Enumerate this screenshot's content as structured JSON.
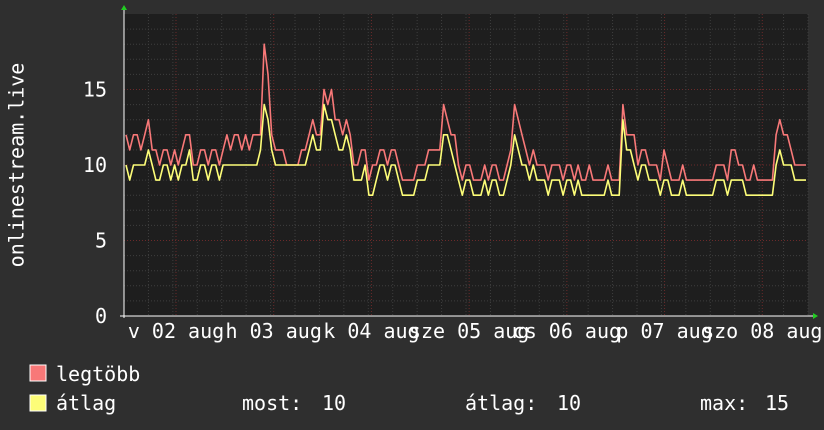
{
  "chart_data": {
    "type": "line",
    "ylabel": "onlinestream.live",
    "ylim": [
      0,
      20
    ],
    "yticks": [
      0,
      5,
      10,
      15
    ],
    "x_ticks": [
      "v 02 aug",
      "h 03 aug",
      "k 04 aug",
      "sze 05 aug",
      "cs 06 aug",
      "p 07 aug",
      "szo 08 aug"
    ],
    "grid": true,
    "colors": {
      "max": "#f87878",
      "avg": "#fdfd78",
      "background": "#1e1e1e",
      "grid_major": "#6b2a2a",
      "grid_minor": "#3e3e3e"
    },
    "series": [
      {
        "name": "legtöbb",
        "values": [
          12,
          11,
          12,
          12,
          11,
          12,
          13,
          11,
          11,
          10,
          11,
          11,
          10,
          11,
          10,
          11,
          12,
          12,
          10,
          10,
          11,
          11,
          10,
          11,
          11,
          10,
          11,
          12,
          11,
          12,
          12,
          11,
          12,
          11,
          12,
          12,
          12,
          18,
          16,
          12,
          11,
          11,
          11,
          10,
          10,
          10,
          10,
          11,
          11,
          12,
          13,
          12,
          12,
          15,
          14,
          15,
          13,
          13,
          12,
          13,
          12,
          10,
          10,
          11,
          11,
          9,
          10,
          10,
          11,
          11,
          10,
          11,
          11,
          10,
          9,
          9,
          9,
          9,
          10,
          10,
          10,
          11,
          11,
          11,
          11,
          14,
          13,
          12,
          12,
          10,
          9,
          10,
          10,
          9,
          9,
          9,
          10,
          9,
          10,
          10,
          9,
          9,
          10,
          11,
          14,
          13,
          12,
          11,
          10,
          11,
          10,
          10,
          10,
          9,
          10,
          10,
          10,
          9,
          10,
          10,
          9,
          10,
          9,
          9,
          10,
          9,
          9,
          9,
          9,
          10,
          9,
          9,
          9,
          14,
          12,
          12,
          12,
          10,
          11,
          11,
          10,
          10,
          10,
          9,
          11,
          10,
          9,
          9,
          9,
          10,
          9,
          9,
          9,
          9,
          9,
          9,
          9,
          9,
          10,
          10,
          10,
          9,
          11,
          11,
          10,
          10,
          9,
          9,
          10,
          9,
          9,
          9,
          9,
          9,
          12,
          13,
          12,
          12,
          11,
          10,
          10,
          10,
          10
        ],
        "name_label": "legtöbb"
      },
      {
        "name": "átlag",
        "values": [
          10,
          9,
          10,
          10,
          10,
          10,
          11,
          10,
          9,
          9,
          10,
          10,
          9,
          10,
          9,
          10,
          10,
          11,
          9,
          9,
          10,
          10,
          9,
          10,
          10,
          9,
          10,
          10,
          10,
          10,
          10,
          10,
          10,
          10,
          10,
          10,
          11,
          14,
          13,
          11,
          10,
          10,
          10,
          10,
          10,
          10,
          10,
          10,
          10,
          11,
          12,
          11,
          11,
          14,
          13,
          13,
          12,
          11,
          11,
          12,
          11,
          9,
          9,
          9,
          10,
          8,
          8,
          9,
          10,
          10,
          9,
          10,
          10,
          9,
          8,
          8,
          8,
          8,
          9,
          9,
          9,
          10,
          10,
          10,
          10,
          12,
          12,
          11,
          10,
          9,
          8,
          9,
          9,
          8,
          8,
          8,
          9,
          8,
          9,
          9,
          8,
          8,
          9,
          10,
          12,
          11,
          10,
          10,
          9,
          10,
          9,
          9,
          9,
          8,
          9,
          9,
          9,
          8,
          9,
          9,
          8,
          9,
          8,
          8,
          8,
          8,
          8,
          8,
          8,
          9,
          8,
          8,
          8,
          13,
          11,
          11,
          10,
          9,
          10,
          10,
          9,
          9,
          9,
          8,
          9,
          9,
          8,
          8,
          8,
          9,
          8,
          8,
          8,
          8,
          8,
          8,
          8,
          8,
          9,
          9,
          9,
          8,
          9,
          9,
          9,
          9,
          8,
          8,
          8,
          8,
          8,
          8,
          8,
          8,
          10,
          11,
          10,
          10,
          10,
          9,
          9,
          9,
          9
        ]
      }
    ],
    "summary": {
      "most_label": "most:",
      "most_value": "10",
      "atlag_label": "átlag:",
      "atlag_value": "10",
      "max_label": "max:",
      "max_value": "15"
    }
  }
}
